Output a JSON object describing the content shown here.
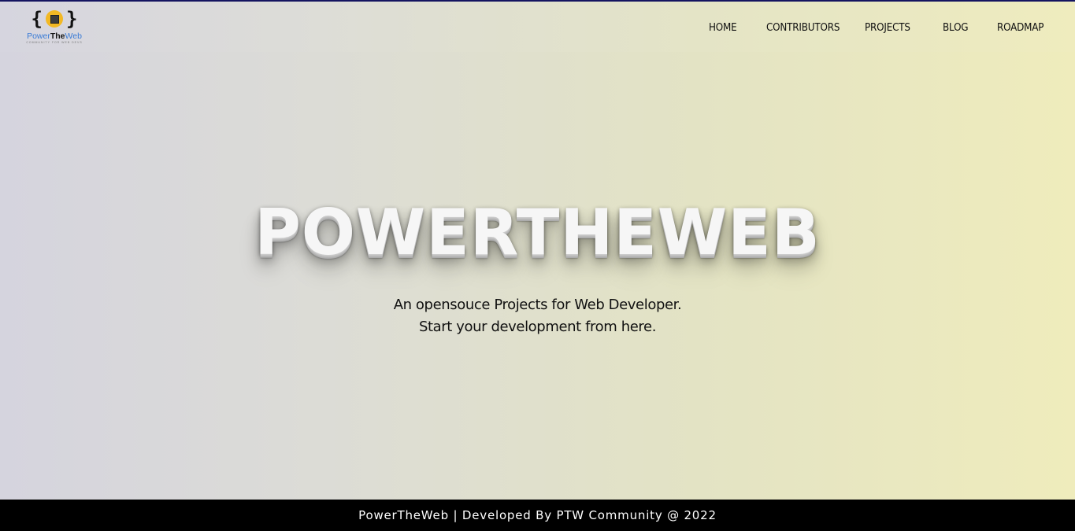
{
  "header": {
    "logo": {
      "name_prefix": "Power",
      "name_mid": "The",
      "name_suffix": "Web",
      "tagline": "COMMUNITY FOR WEB DEVS",
      "brace_left": "{",
      "brace_right": "}",
      "colors": {
        "chip": "#f2b824",
        "text_blue": "#3a7bd5"
      }
    },
    "nav": [
      {
        "label": "HOME"
      },
      {
        "label": "CONTRIBUTORS"
      },
      {
        "label": "PROJECTS"
      },
      {
        "label": "BLOG"
      },
      {
        "label": "ROADMAP"
      }
    ]
  },
  "hero": {
    "title": "POWERTHEWEB",
    "subtitle_line1": "An opensouce Projects for Web Developer.",
    "subtitle_line2": "Start your development from here."
  },
  "footer": {
    "text": "PowerTheWeb | Developed By PTW Community @ 2022"
  },
  "theme": {
    "top_border": "#141460",
    "footer_bg": "#000000",
    "gradient_start": "#d5d4de",
    "gradient_end": "#efecbc"
  }
}
